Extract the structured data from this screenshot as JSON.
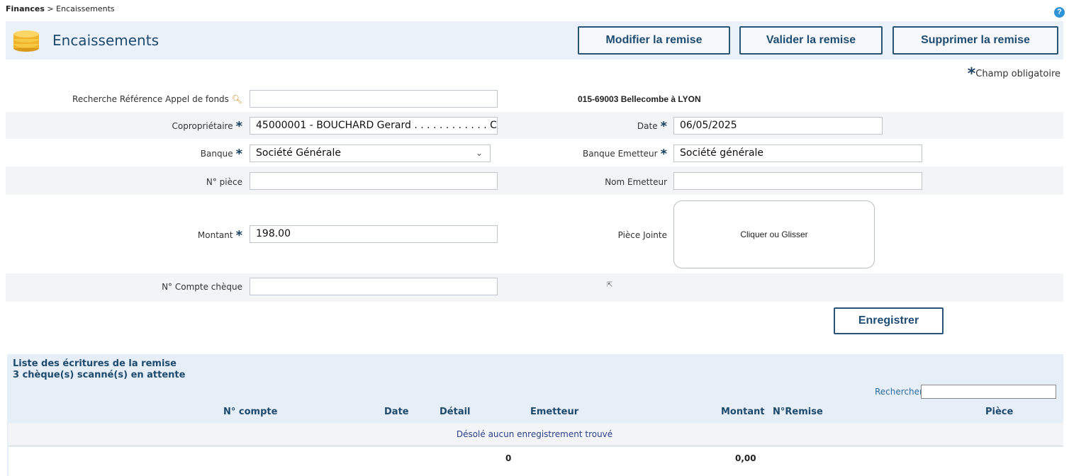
{
  "breadcrumb": {
    "root": "Finances",
    "separator": ">",
    "current": "Encaissements"
  },
  "header": {
    "title": "Encaissements",
    "buttons": {
      "modify": "Modifier la remise",
      "validate": "Valider la remise",
      "delete": "Supprimer la remise"
    }
  },
  "required_note": {
    "star": "*",
    "text": "Champ obligatoire"
  },
  "form": {
    "search_ref_label": "Recherche Référence Appel de fonds",
    "search_ref_value": "",
    "address": "015-69003 Bellecombe à LYON",
    "owner_label": "Copropriétaire",
    "owner_value": "45000001 - BOUCHARD Gerard . . . . . . . . . . . . C",
    "date_label": "Date",
    "date_value": "06/05/2025",
    "bank_label": "Banque",
    "bank_value": "Société Générale",
    "issuer_bank_label": "Banque Emetteur",
    "issuer_bank_value": "Société générale",
    "piece_label": "N° pièce",
    "piece_value": "",
    "issuer_name_label": "Nom Emetteur",
    "issuer_name_value": "",
    "amount_label": "Montant",
    "amount_value": "198.00",
    "attachment_label": "Pièce Jointe",
    "attachment_drop_text": "Cliquer ou Glisser",
    "cheque_account_label": "N° Compte chèque",
    "cheque_account_value": "",
    "required_star": "*",
    "save_label": "Enregistrer"
  },
  "list": {
    "title_line1": "Liste des écritures de la remise",
    "title_line2": "3 chèque(s) scanné(s) en attente",
    "search_label": "Rechercher",
    "columns": [
      "N° compte",
      "Date",
      "Détail",
      "Emetteur",
      "Montant",
      "N°Remise",
      "Pièce"
    ],
    "empty_message": "Désolé aucun enregistrement trouvé",
    "total_count": "0",
    "total_amount": "0,00"
  },
  "colors": {
    "accent": "#1f4c73",
    "header_band": "#eaf1f9",
    "row_band": "#f3f4f6"
  },
  "icons": {
    "header": "coins-stack-icon",
    "search": "magnifier-icon",
    "help": "help-icon"
  }
}
